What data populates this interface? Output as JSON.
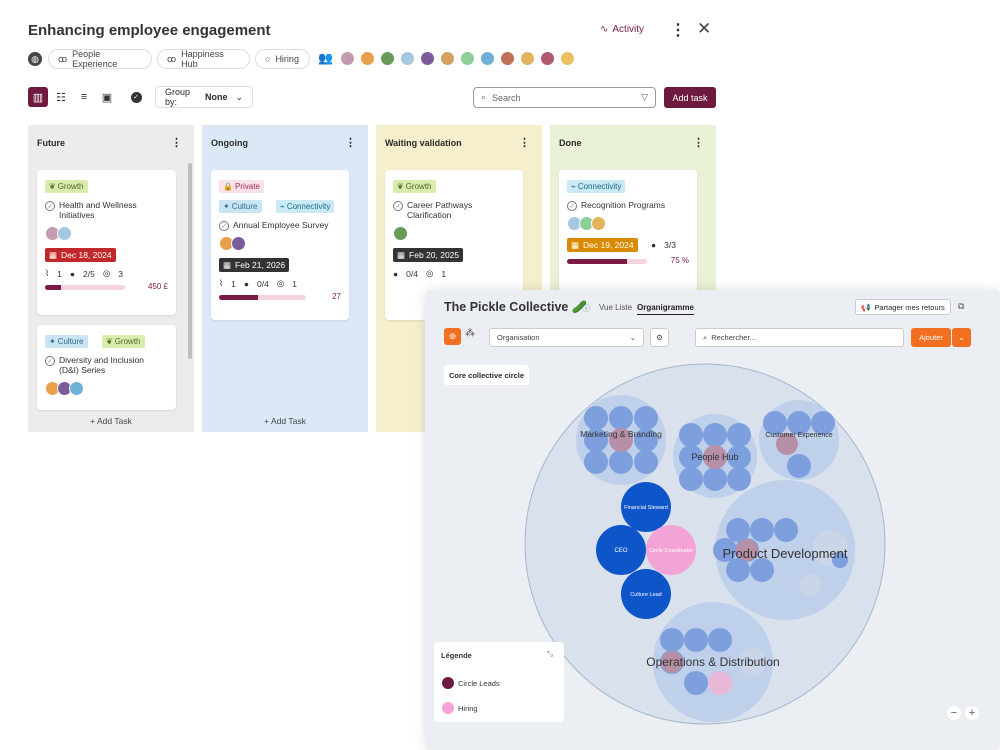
{
  "header": {
    "title": "Enhancing employee engagement",
    "activity_label": "Activity",
    "kebab": "⋮",
    "close": "✕"
  },
  "chips": [
    {
      "label": "People Experience",
      "icon": "circle-group-icon"
    },
    {
      "label": "Happiness Hub",
      "icon": "circle-group-icon"
    },
    {
      "label": "Hiring",
      "icon": "ring-icon"
    }
  ],
  "avatar_colors": [
    "#c49ab0",
    "#e8a04a",
    "#6a9a5a",
    "#a7c7e0",
    "#7a5c9a",
    "#d4a060",
    "#8ccf9a",
    "#6fb0d8",
    "#c0705a",
    "#e3b45e",
    "#b05870",
    "#e8c060"
  ],
  "toolbar": {
    "group_by_label": "Group by:",
    "group_by_value": "None",
    "search_placeholder": "Search",
    "add_task": "Add task"
  },
  "columns": [
    {
      "title": "Future",
      "bg": "#ececec",
      "add": "+ Add Task",
      "cards": [
        {
          "tags": [
            {
              "label": "Growth",
              "kind": "growth"
            }
          ],
          "title": "Health and Wellness Initiatives",
          "date": "Dec 18, 2024",
          "date_color": "#c0282a",
          "attachments": "1",
          "checks": "2/5",
          "goals": "3",
          "progress": 0.2,
          "value": "450 £"
        },
        {
          "tags": [
            {
              "label": "Culture",
              "kind": "culture"
            },
            {
              "label": "Growth",
              "kind": "growth"
            }
          ],
          "title": "Diversity and Inclusion (D&I) Series"
        }
      ]
    },
    {
      "title": "Ongoing",
      "bg": "#dbe9f7",
      "add": "+ Add Task",
      "cards": [
        {
          "tags": [
            {
              "label": "Private",
              "kind": "private"
            }
          ],
          "tags2": [
            {
              "label": "Culture",
              "kind": "culture"
            },
            {
              "label": "Connectivity",
              "kind": "connectivity"
            }
          ],
          "title": "Annual Employee Survey",
          "date": "Feb 21, 2026",
          "date_color": "#333333",
          "attachments": "1",
          "checks": "0/4",
          "goals": "1",
          "progress": 0.45,
          "value": "27"
        }
      ]
    },
    {
      "title": "Waiting validation",
      "bg": "#f5efcd",
      "add": "",
      "cards": [
        {
          "tags": [
            {
              "label": "Growth",
              "kind": "growth"
            }
          ],
          "title": "Career Pathways Clarification",
          "date": "Feb 20, 2025",
          "date_color": "#333333",
          "checks": "0/4",
          "goals": "1"
        }
      ]
    },
    {
      "title": "Done",
      "bg": "#e9f1d6",
      "add": "",
      "cards": [
        {
          "tags": [
            {
              "label": "Connectivity",
              "kind": "connectivity"
            }
          ],
          "title": "Recognition Programs",
          "date": "Dec 19, 2024",
          "date_color": "#d98a00",
          "checks": "3/3",
          "progress": 0.75,
          "value": "75 %"
        }
      ]
    }
  ],
  "org_panel": {
    "title": "The Pickle Collective",
    "tabs": [
      "Vue Liste",
      "Organigramme"
    ],
    "feedback": "Partager mes retours",
    "dropdown_value": "Organisation",
    "search_placeholder": "Rechercher...",
    "add": "Ajouter",
    "core_circle": "Core collective circle",
    "circles": {
      "marketing": "Marketing & Branding",
      "people": "People Hub",
      "customer": "Customer Experience",
      "product": "Product Development",
      "ops": "Operations & Distribution",
      "financial": "Financial Steward",
      "ceo": "CEO",
      "coordinator": "Circle Coordinator",
      "culture": "Culture Lead"
    },
    "legend": {
      "title": "Légende",
      "items": [
        {
          "label": "Circle Leads",
          "color": "#6e1a3f"
        },
        {
          "label": "Hiring",
          "color": "#f3a3d6"
        }
      ]
    },
    "zoom_out": "−",
    "zoom_in": "+"
  }
}
